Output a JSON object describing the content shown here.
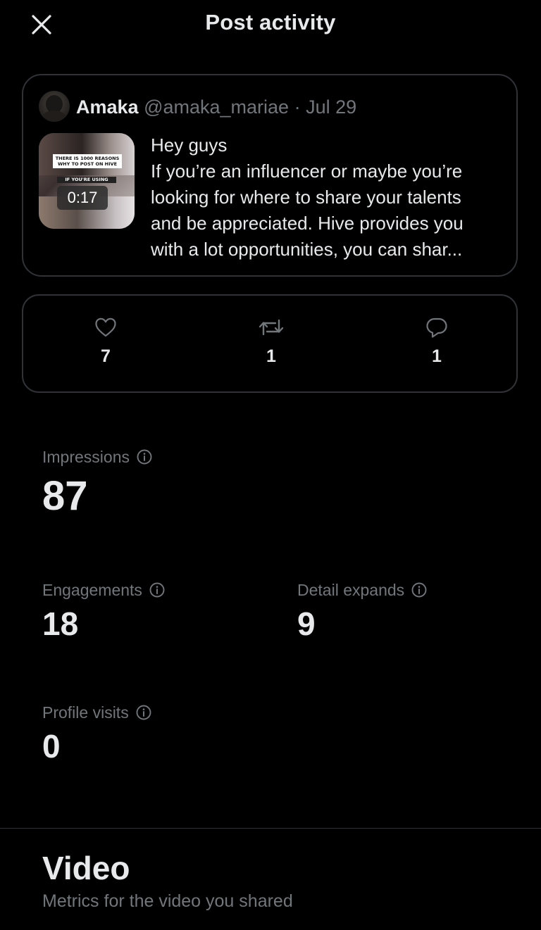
{
  "header": {
    "title": "Post activity",
    "close_icon": "close-icon"
  },
  "post": {
    "author_name": "Amaka",
    "handle": "@amaka_mariae",
    "separator": "·",
    "date": "Jul 29",
    "video_duration": "0:17",
    "thumbnail_caption_top": "THERE IS 1000 REASONS WHY TO POST ON HIVE",
    "thumbnail_caption_bottom": "IF YOU'RE USING",
    "text_lines": [
      "Hey guys",
      "If you’re an influencer or maybe you’re",
      "looking for where to share your talents",
      "and be appreciated. Hive provides you",
      "with a lot opportunities, you can shar..."
    ]
  },
  "counts": {
    "likes": "7",
    "reposts": "1",
    "replies": "1",
    "icons": [
      "heart-icon",
      "repost-icon",
      "reply-icon"
    ]
  },
  "metrics": {
    "impressions": {
      "label": "Impressions",
      "value": "87"
    },
    "engagements": {
      "label": "Engagements",
      "value": "18"
    },
    "detail_expands": {
      "label": "Detail expands",
      "value": "9"
    },
    "profile_visits": {
      "label": "Profile visits",
      "value": "0"
    }
  },
  "video_section": {
    "title": "Video",
    "subtitle": "Metrics for the video you shared"
  },
  "colors": {
    "background": "#000000",
    "primary_text": "#e7e9ea",
    "secondary_text": "#71767b",
    "border": "#2f3336"
  }
}
